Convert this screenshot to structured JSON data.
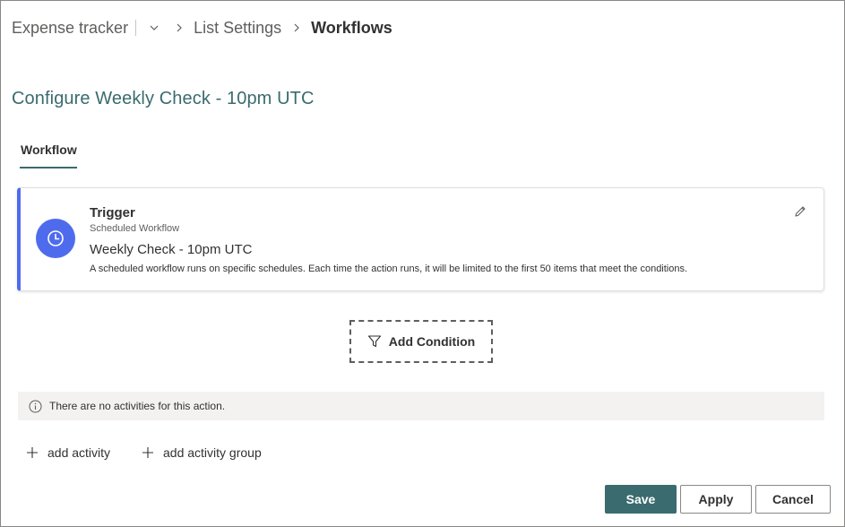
{
  "breadcrumb": {
    "site": "Expense tracker",
    "list_settings": "List Settings",
    "current": "Workflows"
  },
  "page": {
    "title": "Configure Weekly Check - 10pm UTC"
  },
  "tabs": [
    {
      "label": "Workflow",
      "selected": true
    }
  ],
  "trigger": {
    "title": "Trigger",
    "type": "Scheduled Workflow",
    "name": "Weekly Check - 10pm UTC",
    "description": "A scheduled workflow runs on specific schedules. Each time the action runs, it will be limited to the first 50 items that meet the conditions.",
    "icon": "clock-icon",
    "accent": "#4f6bed"
  },
  "condition": {
    "add_label": "Add Condition",
    "icon": "filter-icon"
  },
  "activities": {
    "empty_message": "There are no activities for this action.",
    "add_activity_label": "add activity",
    "add_group_label": "add activity group"
  },
  "actions": {
    "save_label": "Save",
    "apply_label": "Apply",
    "cancel_label": "Cancel"
  },
  "colors": {
    "brand": "#3a6b6f",
    "trigger_accent": "#4f6bed"
  }
}
